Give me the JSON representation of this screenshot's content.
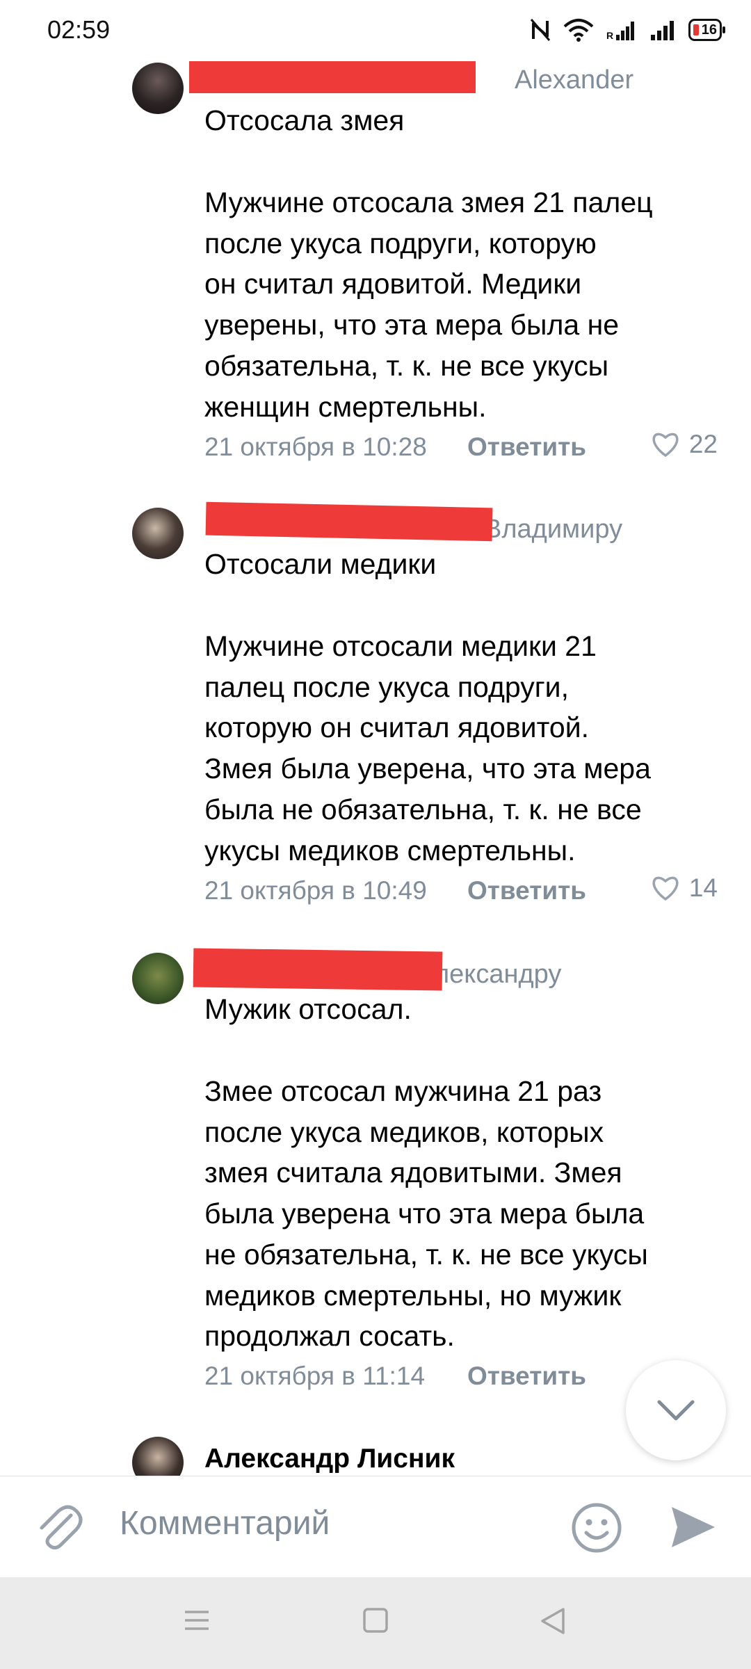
{
  "status_bar": {
    "time": "02:59",
    "battery": "16"
  },
  "comments": [
    {
      "header_visible": "Alexander",
      "title": "Отсосала змея",
      "text": "Мужчине отсосала змея 21 палец\nпосле укуса подруги, которую\nон считал ядовитой. Медики\nуверены, что эта мера была не\nобязательна, т. к. не все укусы\nженщин смертельны.",
      "time": "21 октября в 10:28",
      "reply": "Ответить",
      "likes": "22"
    },
    {
      "header_visible": "Владимиру",
      "title": "Отсосали медики",
      "text": "Мужчине отсосали медики 21\nпалец после укуса подруги,\nкоторую он считал ядовитой.\nЗмея была уверена, что эта мера\nбыла не обязательна, т. к. не все\nукусы медиков смертельны.",
      "time": "21 октября в 10:49",
      "reply": "Ответить",
      "likes": "14"
    },
    {
      "header_visible": "лександру",
      "title": "Мужик отсосал.",
      "text": "Змее отсосал мужчина 21 раз\nпосле укуса медиков, которых\nзмея считала ядовитыми. Змея\nбыла уверена что эта мера была\nне обязательна, т. к. не все укусы\nмедиков смертельны, но мужик\nпродолжал сосать.",
      "time": "21 октября в 11:14",
      "reply": "Ответить"
    },
    {
      "author": "Александр Лисник"
    }
  ],
  "composer": {
    "placeholder": "Комментарий"
  },
  "icons": {
    "nfc": "nfc-icon",
    "wifi": "wifi-icon",
    "signal": "signal-icon",
    "attach": "paperclip-icon",
    "emoji": "emoji-icon",
    "send": "send-icon",
    "scroll": "chevron-down-icon",
    "heart": "heart-icon"
  },
  "colors": {
    "redaction": "#ef3a3a",
    "meta": "#818c99",
    "accent": "#99a2ad"
  }
}
